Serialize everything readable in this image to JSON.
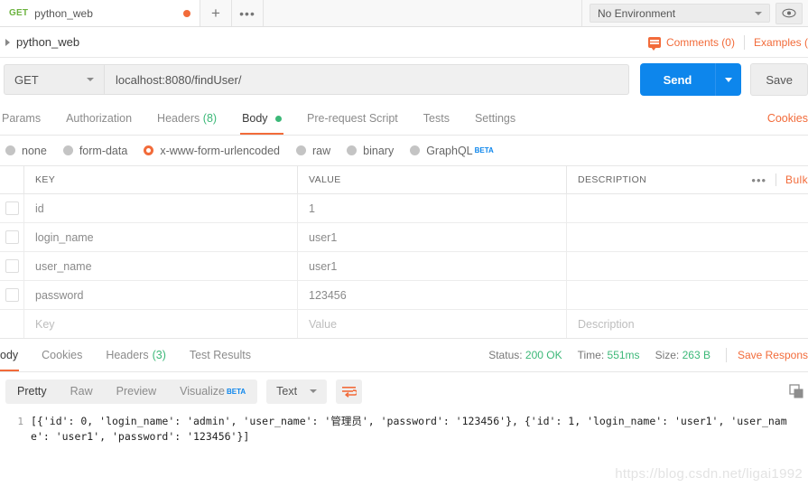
{
  "tabstrip": {
    "request_tab": {
      "method": "GET",
      "name": "python_web",
      "unsaved": "●"
    },
    "new_tab_label": "+",
    "more_label": "•••",
    "environment": {
      "selected": "No Environment"
    },
    "eye_icon": "eye-icon"
  },
  "breadcrumb": {
    "title": "python_web",
    "comments": "Comments (0)",
    "examples": "Examples ("
  },
  "request": {
    "method": "GET",
    "url": "localhost:8080/findUser/",
    "send_label": "Send",
    "save_label": "Save"
  },
  "request_tabs": [
    {
      "label": "Params",
      "active": false
    },
    {
      "label": "Authorization",
      "active": false
    },
    {
      "label": "Headers",
      "count": "(8)",
      "active": false
    },
    {
      "label": "Body",
      "active": true,
      "dot": true
    },
    {
      "label": "Pre-request Script",
      "active": false
    },
    {
      "label": "Tests",
      "active": false
    },
    {
      "label": "Settings",
      "active": false
    }
  ],
  "cookies_link": "Cookies",
  "body_types": [
    {
      "label": "none",
      "selected": false
    },
    {
      "label": "form-data",
      "selected": false
    },
    {
      "label": "x-www-form-urlencoded",
      "selected": true
    },
    {
      "label": "raw",
      "selected": false
    },
    {
      "label": "binary",
      "selected": false
    },
    {
      "label": "GraphQL",
      "selected": false,
      "badge": "BETA"
    }
  ],
  "kv_table": {
    "headers": {
      "key": "KEY",
      "value": "VALUE",
      "description": "DESCRIPTION"
    },
    "dots": "•••",
    "bulk_link": "Bulk",
    "rows": [
      {
        "checked": false,
        "key": "id",
        "value": "1",
        "description": "",
        "placeholder": false
      },
      {
        "checked": false,
        "key": "login_name",
        "value": "user1",
        "description": "",
        "placeholder": false
      },
      {
        "checked": false,
        "key": "user_name",
        "value": "user1",
        "description": "",
        "placeholder": false
      },
      {
        "checked": false,
        "key": "password",
        "value": "123456",
        "description": "",
        "placeholder": false
      },
      {
        "checked": null,
        "key": "Key",
        "value": "Value",
        "description": "Description",
        "placeholder": true
      }
    ]
  },
  "response": {
    "tabs": [
      {
        "label": "ody",
        "active": true
      },
      {
        "label": "Cookies",
        "active": false
      },
      {
        "label": "Headers",
        "count": "(3)",
        "active": false
      },
      {
        "label": "Test Results",
        "active": false
      }
    ],
    "status_label": "Status:",
    "status_value": "200 OK",
    "time_label": "Time:",
    "time_value": "551ms",
    "size_label": "Size:",
    "size_value": "263 B",
    "save_response": "Save Respons",
    "view_tabs": [
      {
        "label": "Pretty",
        "active": true
      },
      {
        "label": "Raw",
        "active": false
      },
      {
        "label": "Preview",
        "active": false
      },
      {
        "label": "Visualize",
        "active": false,
        "badge": "BETA"
      }
    ],
    "format": "Text",
    "wrap_icon": "word-wrap-icon",
    "copy_icon": "copy-icon",
    "line_number": "1",
    "body_text": "[{'id': 0, 'login_name': 'admin', 'user_name': '管理员', 'password': '123456'}, {'id': 1, 'login_name': 'user1', 'user_name': 'user1', 'password': '123456'}]"
  },
  "watermark": "https://blog.csdn.net/ligai1992",
  "colors": {
    "accent": "#f26b3a",
    "send_blue": "#0d86ec",
    "green": "#3cb878",
    "method_green": "#6cb33f"
  }
}
